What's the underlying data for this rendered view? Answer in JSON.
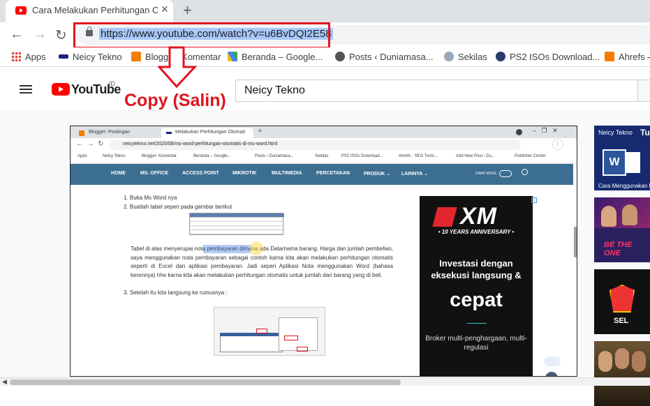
{
  "browser": {
    "tab_title": "Cara Melakukan Perhitungan Oto",
    "tab_close": "✕",
    "new_tab": "+",
    "url": "https://www.youtube.com/watch?v=u6BvDQI2E58",
    "nav": {
      "back": "←",
      "forward": "→",
      "reload": "↻"
    }
  },
  "bookmarks": [
    {
      "label": "Apps",
      "color": "#e94235"
    },
    {
      "label": "Neicy Tekno",
      "color": "#1a237e"
    },
    {
      "label": "Blogger: Komentar",
      "color": "#f57c00"
    },
    {
      "label": "Beranda – Google...",
      "color": "#4285f4"
    },
    {
      "label": "Posts ‹ Duniamasa...",
      "color": "#555555"
    },
    {
      "label": "Sekilas",
      "color": "#7a8a9a"
    },
    {
      "label": "PS2 ISOs Download...",
      "color": "#2a3a6a"
    },
    {
      "label": "Ahrefs -",
      "color": "#f57c00"
    }
  ],
  "youtube": {
    "logo_text": "YouTube",
    "region": "ID",
    "search_value": "Neicy Tekno"
  },
  "annotation": {
    "copy_label": "Copy (Salin)",
    "accent": "#e0141e"
  },
  "video": {
    "inner_tabs": [
      "Blogger: Postingan",
      "Melakukan Perhitungan Otomati"
    ],
    "inner_url": "neicytekno.net/2020/06/ms-word-perhitungan-otomatis-di-ms-word.html",
    "inner_bookmarks": [
      "Apps",
      "Neicy Tekno",
      "Blogger: Komentar",
      "Beranda – Google...",
      "Posts ‹ Duniamasa...",
      "Sekilas",
      "PS2 ISOs Download...",
      "Ahrefs - SEO Tools...",
      "Add New Post ‹ Du...",
      "Publisher Center"
    ],
    "site_nav": [
      "HOME",
      "MS. OFFICE",
      "ACCESS POINT",
      "MIKROTIK",
      "MULTIMEDIA",
      "PERCETAKAN",
      "PRODUK ⌄",
      "LAINNYA ⌄"
    ],
    "dark_mode_label": "DARK MODE",
    "list_items": [
      "1. Buka Ms Word nya",
      "2. Buatlah tabel seperi pada gambar berikut"
    ],
    "paragraph": "Tabel di atas menyerupai nota pembayaran dimana ada Data/nama barang, Harga dan jumlah pembelian, saya menggunakan nota pembayaran sebagai contoh karna kita akan melakukan perhitungan otomatis seperti di Excel dan aplikasi pembayaran. Jadi seperi Aplikasi Nota menggunakan Word (bahasa kerennya) hhe karna kita akan melakukan perhitungan otomatis untuk jumlah dari barang yang di beli.",
    "list_item_3": "3. Setelah itu kita langsung ke rumusnya :",
    "ad": {
      "logo": "XM",
      "tagline": "• 10 YEARS ANNIVERSARY •",
      "headline": "Investasi dengan eksekusi langsung &",
      "big": "cepat",
      "foot": "Broker multi-penghargaan, multi-regulasi"
    }
  },
  "sidebar": {
    "thumb_caption_1": "Neicy Tekno",
    "thumb_caption_1b": "Tu",
    "thumb_caption_1c": "Cara Menggunakan F",
    "thumb_caption_3": "SEL"
  }
}
